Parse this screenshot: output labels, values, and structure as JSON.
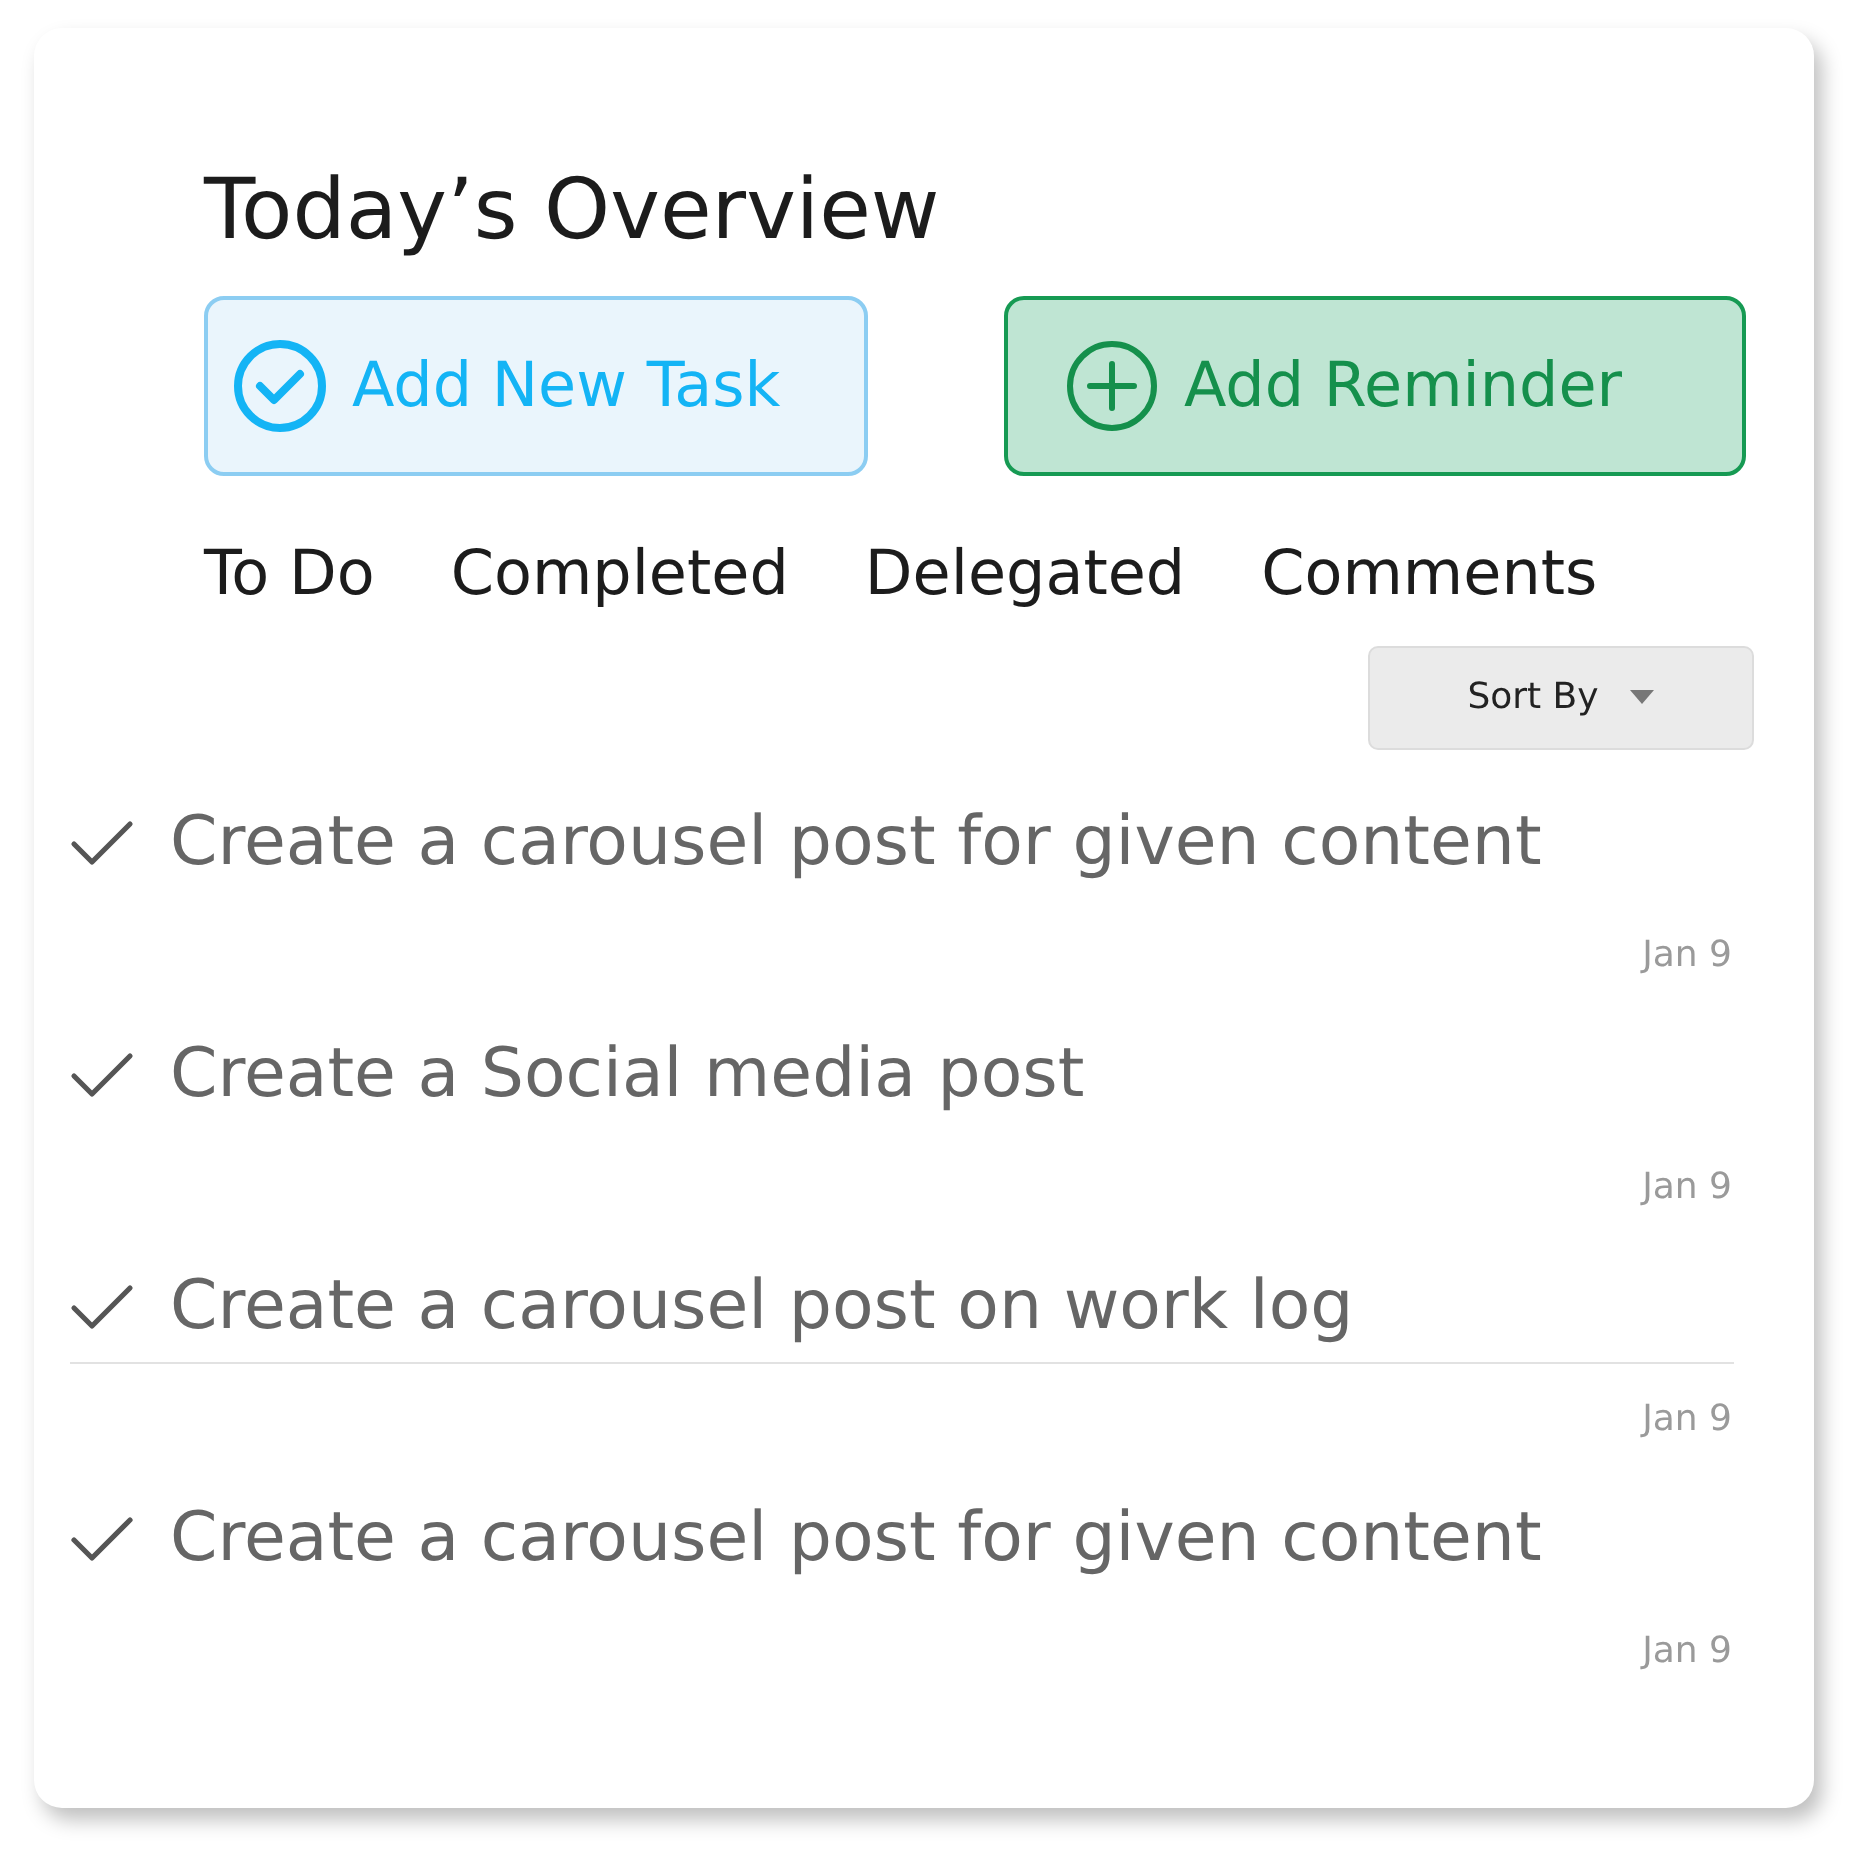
{
  "title": "Today’s Overview",
  "actions": [
    {
      "kind": "task",
      "label": "Add New Task"
    },
    {
      "kind": "reminder",
      "label": "Add Reminder"
    }
  ],
  "tabs": [
    "To Do",
    "Completed",
    "Delegated",
    "Comments"
  ],
  "sort": {
    "label": "Sort By"
  },
  "tasks": [
    {
      "text": "Create a carousel post for given content",
      "date": "Jan 9",
      "divider": false
    },
    {
      "text": "Create a Social media post",
      "date": "Jan 9",
      "divider": false
    },
    {
      "text": "Create a carousel post on work log",
      "date": "Jan 9",
      "divider": true
    },
    {
      "text": "Create a carousel post for given content",
      "date": "Jan 9",
      "divider": false
    }
  ]
}
